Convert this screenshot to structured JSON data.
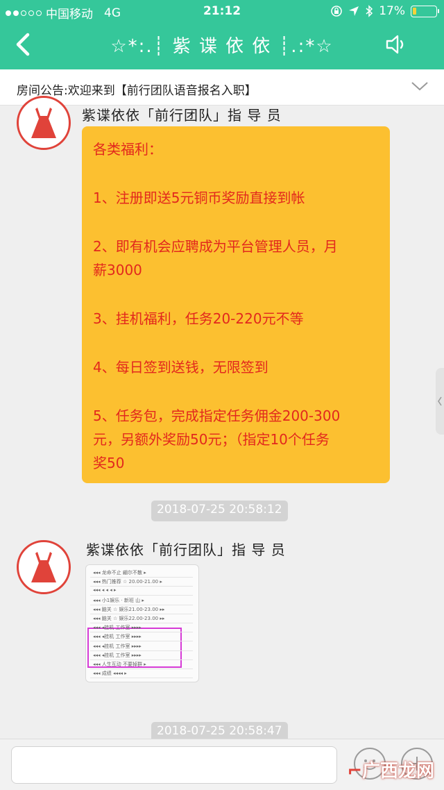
{
  "status_bar": {
    "carrier": "中国移动",
    "network": "4G",
    "time": "21:12",
    "battery": "17%",
    "battery_level": 0.17
  },
  "nav": {
    "title": "☆*:.┊ 紫 谍 依 依 ┊.:*☆",
    "back_icon": "chevron-left-icon",
    "speaker_icon": "speaker-icon"
  },
  "notice": {
    "text": "房间公告:欢迎来到【前行团队语音报名入职】"
  },
  "messages": [
    {
      "sender": "紫谍依依「前行团队」指 导 员",
      "lines": [
        "各类福利：",
        "",
        "1、注册即送5元铜币奖励直接到帐",
        "",
        "2、即有机会应聘成为平台管理人员，月",
        "薪3000",
        "",
        "3、挂机福利，任务20-220元不等",
        "",
        "4、每日签到送钱，无限签到",
        "",
        "5、任务包，完成指定任务佣金200-300",
        "元，另额外奖励50元；（指定10个任务",
        "奖50"
      ]
    },
    {
      "timestamp": "2018-07-25 20:58:12",
      "sender": "紫谍依依「前行团队」指 导 员",
      "image_lines": [
        "◂◂◂ 龙命不止 翩尔不散 ▸",
        "◂◂◂ 热门推荐 ☆ 20.00-21.00 ▸",
        "◂◂◂  ◂  ◂  ◂  ▸",
        "◂◂◂ 小1娱乐 · 新班 山 ▸",
        "◂◂◂ 脑关 ☆ 娱乐21.00-23.00 ▸▸",
        "◂◂◂ 脑关 ☆ 娱乐22.00-23.00 ▸▸",
        "◂◂◂ ◂挂机 工作室 ▸▸▸▸",
        "◂◂◂ ◂挂机 工作室 ▸▸▸▸",
        "◂◂◂ ◂挂机 工作室 ▸▸▸▸",
        "◂◂◂ ◂挂机 工作室 ▸▸▸▸",
        "◂◂◂ 人生互动 不要掉群 ▸",
        "◂◂◂  成绩 ◂◂◂◂ ▸"
      ]
    },
    {
      "timestamp": "2018-07-25 20:58:47"
    }
  ],
  "input_bar": {
    "emoji_icon": "emoji-icon",
    "add_icon": "plus-icon"
  },
  "watermark": {
    "text": "广西龙网"
  },
  "colors": {
    "header": "#35c79a",
    "bubble": "#fcc030",
    "bubble_text": "#e2281d",
    "avatar_border": "#e0433a",
    "highlight_box": "#d63ad6"
  }
}
